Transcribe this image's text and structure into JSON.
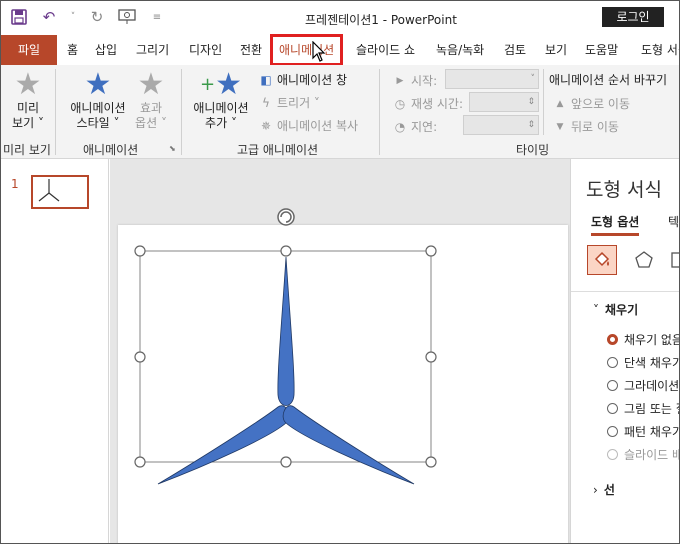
{
  "title_bar": {
    "doc_title": "프레젠테이션1  -  PowerPoint",
    "login_label": "로그인",
    "qat_icons": [
      "save-icon",
      "undo-icon",
      "redo-icon",
      "present-icon",
      "customize-icon"
    ]
  },
  "tabs": {
    "file": "파일",
    "items": [
      "홈",
      "삽입",
      "그리기",
      "디자인",
      "전환",
      "애니메이션",
      "슬라이드 쇼",
      "녹음/녹화",
      "검토",
      "보기",
      "도움말",
      "도형 서식"
    ],
    "active": "애니메이션"
  },
  "ribbon": {
    "preview": {
      "label_line1": "미리",
      "label_line2": "보기 ˅",
      "group": "미리 보기"
    },
    "animation_style": {
      "label_line1": "애니메이션",
      "label_line2": "스타일 ˅"
    },
    "effect_options": {
      "label_line1": "효과",
      "label_line2": "옵션 ˅"
    },
    "animation_group": "애니메이션",
    "add_animation": {
      "label_line1": "애니메이션",
      "label_line2": "추가 ˅"
    },
    "animation_pane": "애니메이션 창",
    "trigger": "트리거 ˅",
    "animation_painter": "애니메이션 복사",
    "advanced_group": "고급 애니메이션",
    "start_label": "시작:",
    "duration_label": "재생 시간:",
    "delay_label": "지연:",
    "reorder_label": "애니메이션 순서 바꾸기",
    "move_earlier": "앞으로 이동",
    "move_later": "뒤로 이동",
    "timing_group": "타이밍"
  },
  "thumbnails": {
    "slide_number": "1"
  },
  "format_pane": {
    "title": "도형 서식",
    "tab_shape_options": "도형 옵션",
    "tab_text_options": "텍",
    "fill_section": "채우기",
    "fill_options": [
      {
        "label": "채우기 없음",
        "selected": true,
        "disabled": false
      },
      {
        "label": "단색 채우기",
        "selected": false,
        "disabled": false
      },
      {
        "label": "그라데이션 채우기",
        "selected": false,
        "disabled": false
      },
      {
        "label": "그림 또는 질감 채우기",
        "selected": false,
        "disabled": false
      },
      {
        "label": "패턴 채우기",
        "selected": false,
        "disabled": false
      },
      {
        "label": "슬라이드 배경 채우기",
        "selected": false,
        "disabled": true
      }
    ],
    "line_section": "선"
  },
  "colors": {
    "accent": "#b7472a",
    "highlight_box": "#e02020",
    "shape_fill": "#4472c4",
    "star_blue": "#3f6fbf"
  }
}
